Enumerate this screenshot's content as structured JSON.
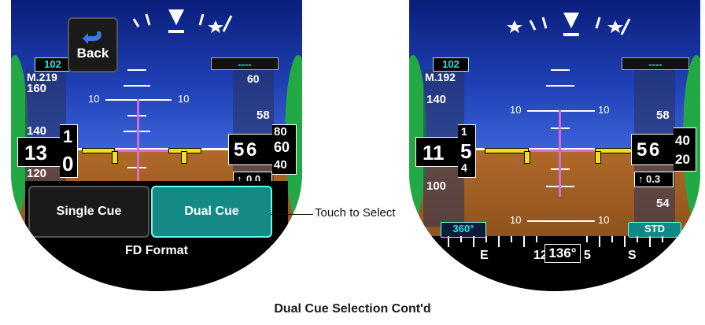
{
  "left_display": {
    "back_label": "Back",
    "speed_bug": "102",
    "mach": "M.219",
    "speed_tape": [
      "160",
      "140",
      "120"
    ],
    "speed_current_main": "13",
    "speed_current_digits": [
      "1",
      "0"
    ],
    "pitch_labels": [
      "10",
      "10"
    ],
    "alt_tape_top": "60",
    "alt_current_main": "5",
    "alt_current_sub": "6",
    "alt_current_digits": [
      "80",
      "60",
      "40"
    ],
    "alt_small": "58",
    "vs_readout": "0.0",
    "alt_bug": "----",
    "buttons": {
      "single_cue": "Single Cue",
      "dual_cue": "Dual Cue"
    },
    "panel_title": "FD Format"
  },
  "right_display": {
    "speed_bug": "102",
    "mach": "M.192",
    "speed_tape": [
      "140",
      "100"
    ],
    "speed_current_main": "11",
    "speed_current_digit": "5",
    "speed_digit_top": "1",
    "speed_digit_bottom": "4",
    "pitch_labels_top": [
      "10",
      "10"
    ],
    "pitch_labels_bottom": [
      "10",
      "10"
    ],
    "alt_current_main": "5",
    "alt_current_sub": "6",
    "alt_current_digits": [
      "40",
      "20"
    ],
    "alt_small_top": "58",
    "alt_small_bottom": "54",
    "vs_readout": "0.3",
    "heading_bug": "360°",
    "baro": "STD",
    "heading_value": "136°",
    "heading_marks": [
      "E",
      "12",
      "5",
      "S"
    ],
    "alt_bug": "----"
  },
  "callout": "Touch to Select",
  "caption": "Dual Cue Selection Cont'd"
}
